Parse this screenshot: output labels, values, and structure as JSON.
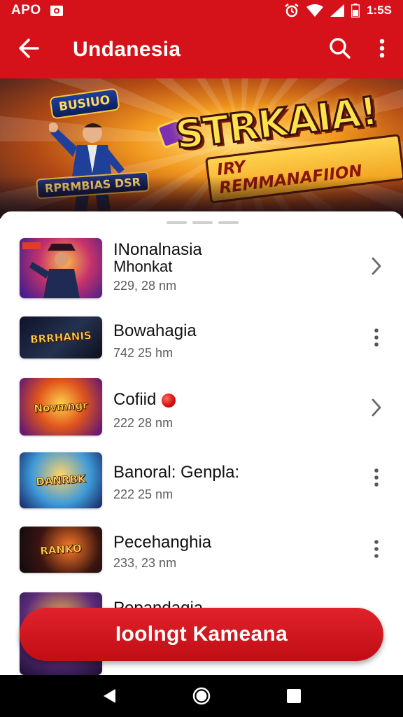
{
  "status_bar": {
    "left_text": "APO",
    "time": "1:5S",
    "icons": [
      "camera-icon",
      "alarm-icon",
      "wifi-icon",
      "signal-icon",
      "battery-icon"
    ]
  },
  "app_bar": {
    "title": "Undanesia",
    "icons": [
      "back-arrow-icon",
      "search-icon",
      "more-vert-icon"
    ]
  },
  "banner": {
    "title": "STRKAIA!",
    "subtitle": "IRY REMMANAFIION",
    "hero_badge": "BUSIUO",
    "hero_plate": "RPRMBIAS DSR"
  },
  "list": {
    "items": [
      {
        "title": "INonalnasia",
        "title2": "Mhonkat",
        "meta": "229, 28 nm",
        "thumb_label": "",
        "action": "chevron-right-icon"
      },
      {
        "title": "Bowahagia",
        "title2": "",
        "meta": "742 25 hm",
        "thumb_label": "BRRHANIS",
        "action": "more-vert-icon"
      },
      {
        "title": "Cofiid",
        "title2": "",
        "meta": "222 28 nm",
        "thumb_label": "Novmngr",
        "action": "chevron-right-icon"
      },
      {
        "title": "Banoral: Genpla:",
        "title2": "",
        "meta": "222 25 nm",
        "thumb_label": "DANRBK",
        "action": "more-vert-icon"
      },
      {
        "title": "Pecehanghia",
        "title2": "",
        "meta": "233, 23 nm",
        "thumb_label": "RANKO",
        "action": "more-vert-icon"
      },
      {
        "title": "Popandagia",
        "title2": "",
        "meta": "",
        "thumb_label": "",
        "action": "more-vert-icon"
      }
    ]
  },
  "cta": {
    "label": "Ioolngt Kameana"
  },
  "nav_bar": {
    "icons": [
      "back-triangle-icon",
      "home-circle-icon",
      "recents-square-icon"
    ]
  },
  "colors": {
    "primary": "#d5121a",
    "cta": "#d4161e",
    "text": "#111111",
    "meta": "#5e5e5e"
  }
}
